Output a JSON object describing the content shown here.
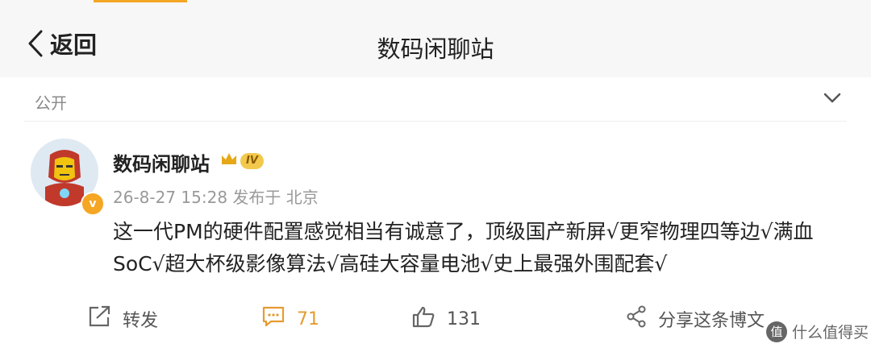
{
  "header": {
    "back_label": "返回",
    "title": "数码闲聊站"
  },
  "post": {
    "privacy": "公开",
    "author": {
      "name": "数码闲聊站",
      "level_badge": "IV",
      "verified_badge": "v"
    },
    "meta": "26-8-27 15:28 发布于 北京",
    "content": "这一代PM的硬件配置感觉相当有诚意了，顶级国产新屏√更窄物理四等边√满血SoC√超大杯级影像算法√高硅大容量电池√史上最强外围配套√"
  },
  "actions": {
    "repost_label": "转发",
    "comment_count": "71",
    "like_count": "131",
    "share_label": "分享这条博文"
  },
  "watermark": {
    "icon_text": "值",
    "text": "什么值得买"
  },
  "colors": {
    "accent": "#f5a623",
    "comment": "#e69b2f",
    "topbar": "#f7f7f7"
  }
}
